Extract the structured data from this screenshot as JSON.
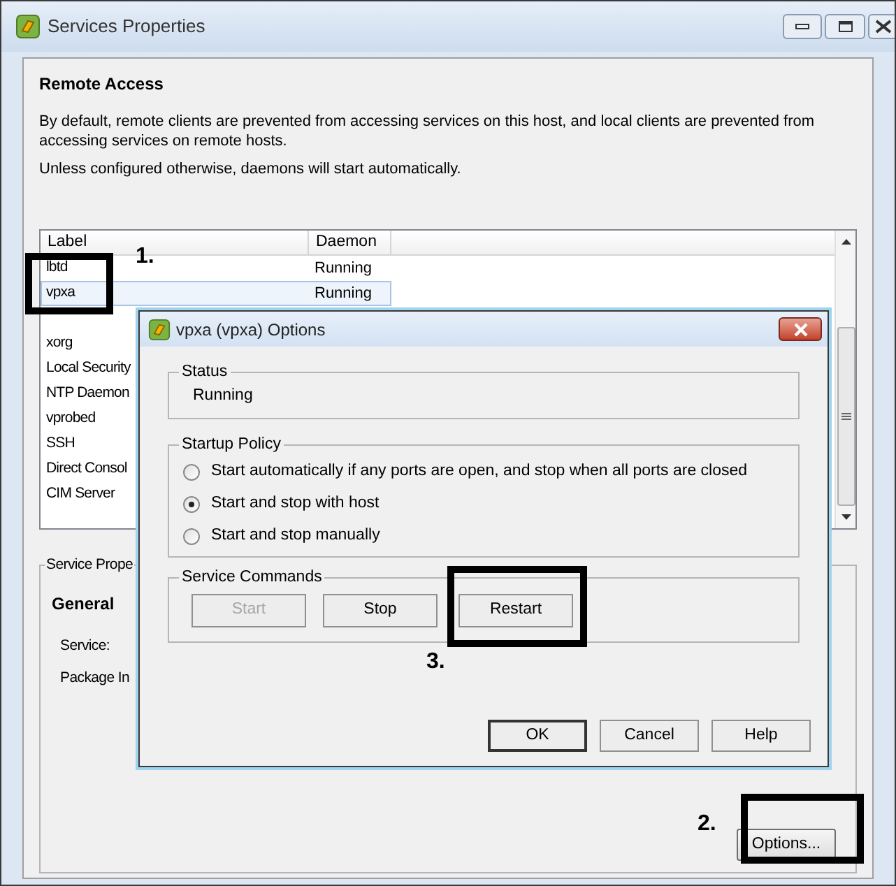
{
  "window": {
    "title": "Services Properties"
  },
  "remote_access": {
    "heading": "Remote Access",
    "paragraphs": [
      "By default, remote clients are prevented from accessing services on this host, and local clients are prevented from accessing services on remote hosts.",
      "Unless configured otherwise, daemons will start automatically."
    ]
  },
  "table": {
    "columns": [
      "Label",
      "Daemon"
    ],
    "rows": [
      {
        "label": "lbtd",
        "daemon": "Running",
        "selected": false
      },
      {
        "label": "vpxa",
        "daemon": "Running",
        "selected": true
      },
      {
        "label": "xorg",
        "selected": false
      },
      {
        "label": "Local Security",
        "selected": false
      },
      {
        "label": "NTP Daemon",
        "selected": false
      },
      {
        "label": "vprobed",
        "selected": false
      },
      {
        "label": "SSH",
        "selected": false
      },
      {
        "label": "Direct Consol",
        "selected": false
      },
      {
        "label": "CIM Server",
        "selected": false
      }
    ]
  },
  "service_properties": {
    "title": "Service Prope",
    "heading": "General",
    "fields": [
      "Service:",
      "Package In"
    ]
  },
  "options_button": "Options...",
  "dialog": {
    "title": "vpxa (vpxa) Options",
    "status": {
      "title": "Status",
      "value": "Running"
    },
    "startup_policy": {
      "title": "Startup Policy",
      "options": [
        {
          "label": "Start automatically if any ports are open, and stop when all ports are closed",
          "selected": false
        },
        {
          "label": "Start and stop with host",
          "selected": true
        },
        {
          "label": "Start and stop manually",
          "selected": false
        }
      ]
    },
    "service_commands": {
      "title": "Service Commands",
      "buttons": [
        {
          "label": "Start",
          "disabled": true
        },
        {
          "label": "Stop",
          "disabled": false
        },
        {
          "label": "Restart",
          "disabled": false
        }
      ]
    },
    "buttons": [
      {
        "label": "OK",
        "default": true
      },
      {
        "label": "Cancel",
        "default": false
      },
      {
        "label": "Help",
        "default": false
      }
    ]
  },
  "annotations": [
    "1.",
    "2.",
    "3."
  ]
}
